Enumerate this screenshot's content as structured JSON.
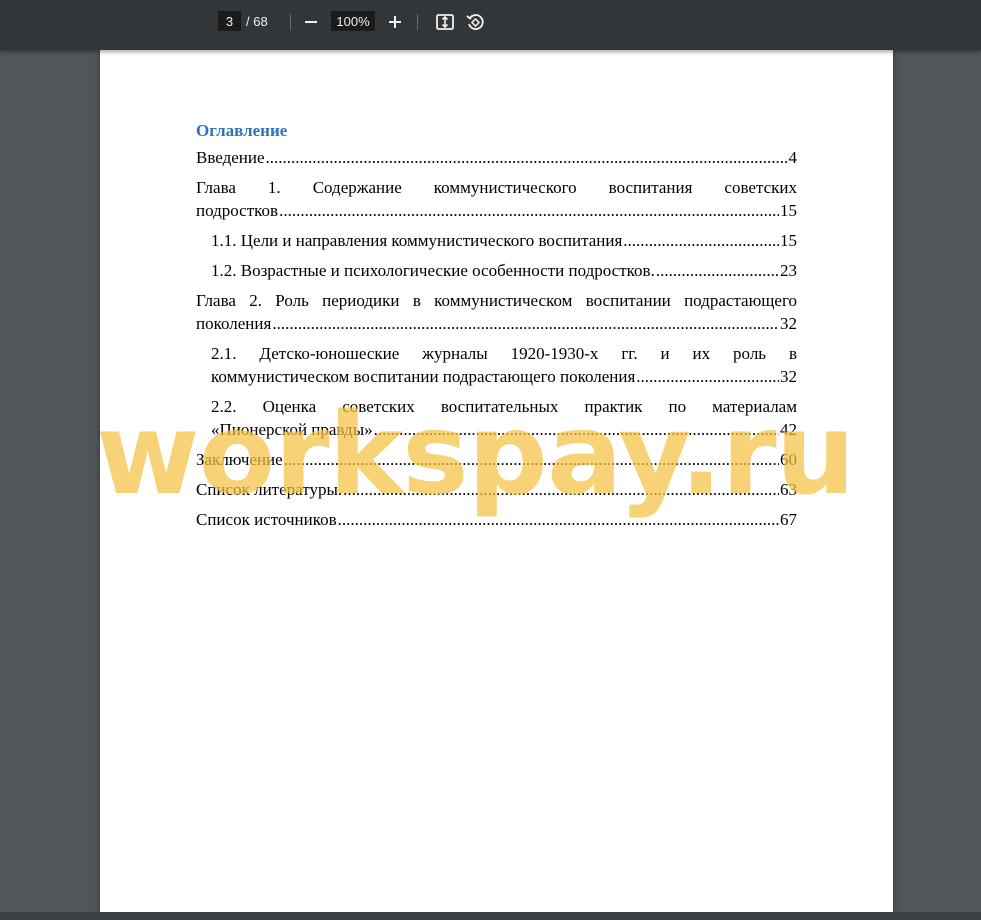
{
  "toolbar": {
    "page_current": "3",
    "page_total": "/ 68",
    "zoom": "100%",
    "zoom_out_icon": "minus-icon",
    "zoom_in_icon": "plus-icon",
    "fit_icon": "fit-to-page-icon",
    "rotate_icon": "rotate-icon"
  },
  "document": {
    "toc_title": "Оглавление",
    "entries": [
      {
        "label": "Введение",
        "page": "4"
      },
      {
        "line1": "Глава 1. Содержание коммунистического воспитания советских",
        "label": "подростков",
        "page": "15"
      },
      {
        "label": "1.1. Цели и направления коммунистического воспитания",
        "page": "15"
      },
      {
        "label": "1.2. Возрастные и психологические особенности подростков.",
        "page": "23"
      },
      {
        "line1": "Глава 2. Роль периодики в коммунистическом воспитании подрастающего",
        "label": "поколения",
        "page": "32"
      },
      {
        "line1": "2.1. Детско-юношеские  журналы 1920-1930-х гг. и их роль в",
        "label": "коммунистическом воспитании подрастающего поколения",
        "page": "32"
      },
      {
        "line1": "2.2. Оценка советских воспитательных практик по материалам",
        "label": "«Пионерской правды»",
        "page": "42"
      },
      {
        "label": "Заключение",
        "page": "60"
      },
      {
        "label": "Список литературы.",
        "page": "63"
      },
      {
        "label": "Список источников",
        "page": "67"
      }
    ]
  },
  "watermark": "workspay.ru",
  "colors": {
    "toolbar": "#323639",
    "background": "#525659",
    "heading": "#2e74b5",
    "watermark": "#f5c242"
  }
}
